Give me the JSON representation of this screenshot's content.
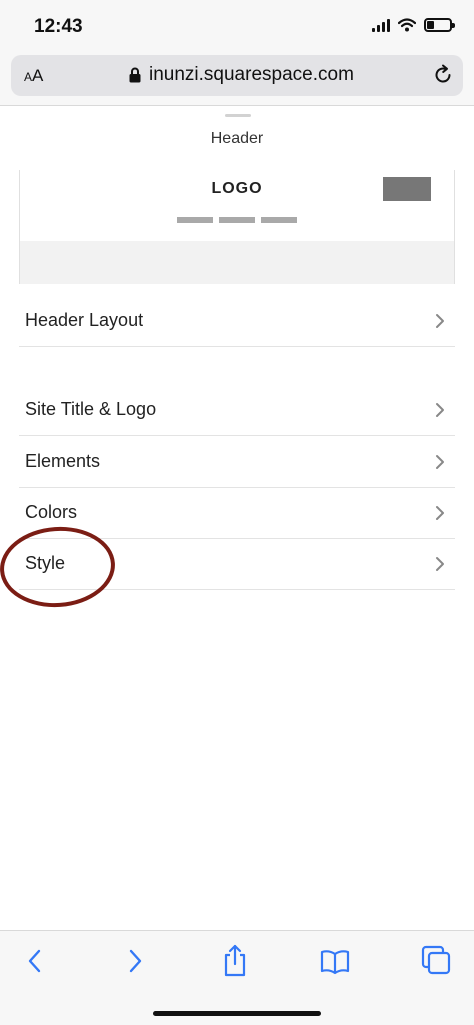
{
  "status_bar": {
    "time": "12:43"
  },
  "address_bar": {
    "text_size_label": "AA",
    "url": "inunzi.squarespace.com"
  },
  "panel": {
    "title": "Header"
  },
  "preview": {
    "logo_text": "LOGO"
  },
  "menu": {
    "items": [
      {
        "label": "Header Layout"
      },
      {
        "label": "Site Title & Logo"
      },
      {
        "label": "Elements"
      },
      {
        "label": "Colors"
      },
      {
        "label": "Style"
      }
    ]
  },
  "toolbar": {
    "icons": [
      "back-icon",
      "forward-icon",
      "share-icon",
      "bookmarks-icon",
      "tabs-icon"
    ]
  },
  "colors": {
    "accent": "#3478f6",
    "highlight": "#7b1d14",
    "text": "#222222"
  }
}
